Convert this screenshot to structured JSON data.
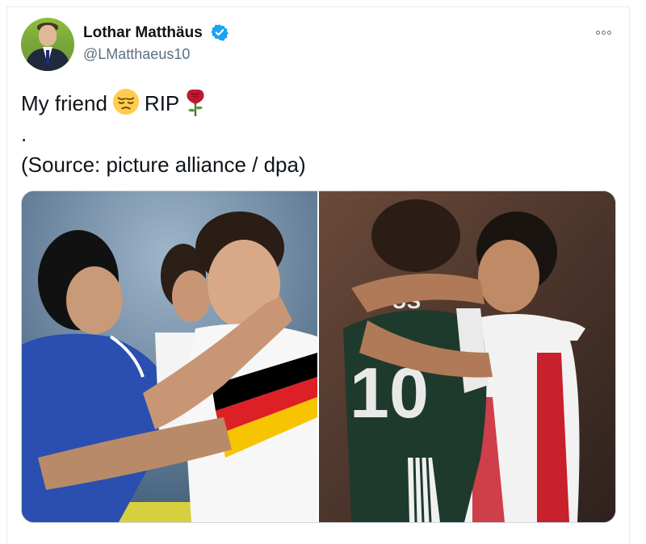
{
  "author": {
    "name": "Lothar Matthäus",
    "handle": "@LMatthaeus10",
    "verified": true,
    "avatar_icon": "profile-photo"
  },
  "tweet": {
    "line1_before": "My friend",
    "line1_after": "RIP",
    "emoji_1": "pensive-face",
    "emoji_2": "wilted-rose",
    "line2": ".",
    "line3": "(Source: picture alliance / dpa)"
  },
  "media": {
    "photos": [
      {
        "description_icon": "photo-football-players-embrace-1990",
        "jersey_text": ""
      },
      {
        "description_icon": "photo-football-players-hug",
        "jersey_text": "10",
        "jersey_letters": "US"
      }
    ]
  },
  "colors": {
    "verified_blue": "#1da1f2",
    "text": "#0f1419",
    "muted": "#5b7083"
  }
}
